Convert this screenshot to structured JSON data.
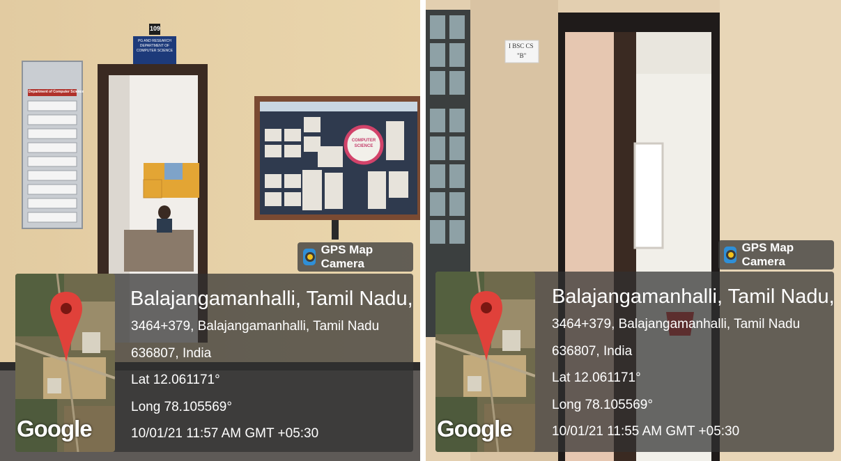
{
  "photos": [
    {
      "badge": "GPS Map Camera",
      "map_logo": "Google",
      "place": "Balajangamanhalli, Tamil Nadu, India",
      "address_line1": "3464+379, Balajangamanhalli, Tamil Nadu",
      "address_line2": "636807, India",
      "lat": "Lat 12.061171°",
      "long": "Long 78.105569°",
      "timestamp": "10/01/21 11:57 AM GMT +05:30",
      "room_number": "109",
      "door_sign": "PG AND RESEARCH DEPARTMENT OF COMPUTER SCIENCE",
      "notice_title": "Department of Computer Science",
      "board_label": "COMPUTER SCIENCE"
    },
    {
      "badge": "GPS Map Camera",
      "map_logo": "Google",
      "place": "Balajangamanhalli, Tamil Nadu, India",
      "address_line1": "3464+379, Balajangamanhalli, Tamil Nadu",
      "address_line2": "636807, India",
      "lat": "Lat 12.061171°",
      "long": "Long 78.105569°",
      "timestamp": "10/01/21 11:55 AM GMT +05:30",
      "class_sign_line1": "I BSC CS",
      "class_sign_line2": "\"B\""
    }
  ],
  "colors": {
    "wall": "#e6cfa6",
    "door_frame": "#3a2a22",
    "pin": "#e0413a",
    "board_frame": "#7a4a32",
    "panel": "#303030"
  }
}
